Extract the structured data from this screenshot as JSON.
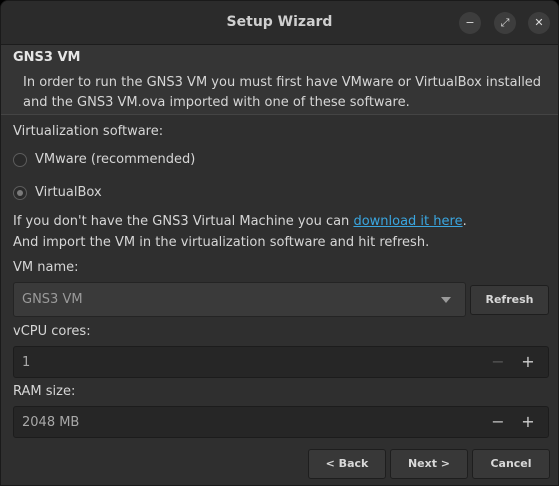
{
  "window": {
    "title": "Setup Wizard",
    "buttons": {
      "minimize": "−",
      "maximize": "⤢",
      "close": "✕"
    }
  },
  "header": {
    "title": "GNS3 VM",
    "description": "In order to run the GNS3 VM you must first have VMware or VirtualBox installed and the GNS3 VM.ova imported with one of these software."
  },
  "virtualization": {
    "label": "Virtualization software:",
    "options": [
      {
        "label": "VMware (recommended)",
        "checked": false
      },
      {
        "label": "VirtualBox",
        "checked": true
      }
    ]
  },
  "info": {
    "line1_prefix": "If you don't have the GNS3 Virtual Machine you can ",
    "link_text": "download it here",
    "line1_suffix": ".",
    "line2": "And import the VM in the virtualization software and hit refresh."
  },
  "vm_name": {
    "label": "VM name:",
    "value": "GNS3 VM",
    "refresh_label": "Refresh"
  },
  "vcpu": {
    "label": "vCPU cores:",
    "value": "1",
    "minus": "−",
    "plus": "+"
  },
  "ram": {
    "label": "RAM size:",
    "value": "2048 MB",
    "minus": "−",
    "plus": "+"
  },
  "footer": {
    "back_label": "< Back",
    "next_label": "Next >",
    "cancel_label": "Cancel"
  },
  "colors": {
    "link": "#3aa6e0",
    "background": "#2f2f2f"
  }
}
